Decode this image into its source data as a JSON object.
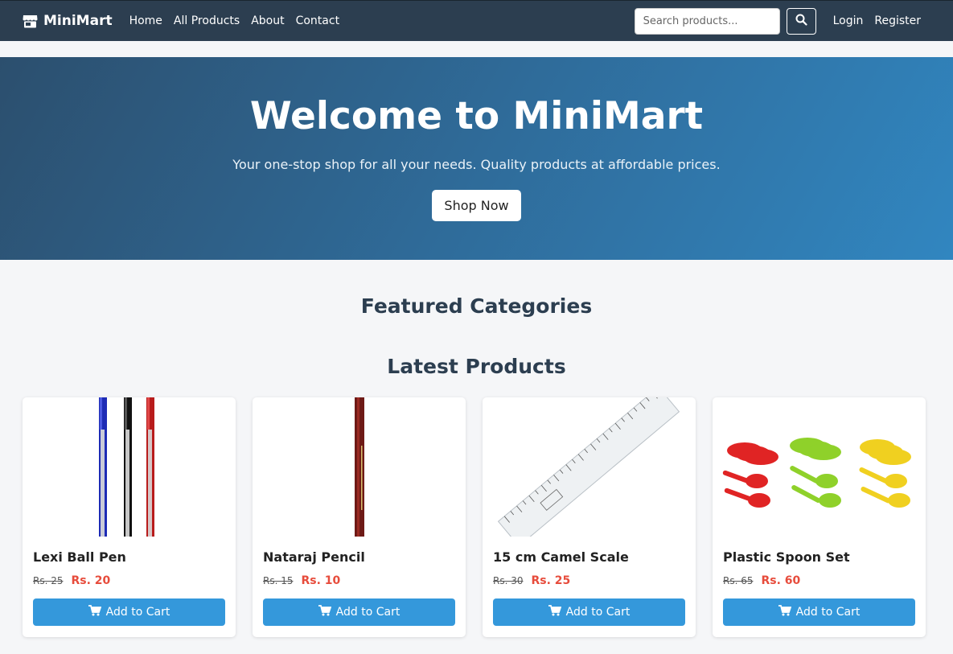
{
  "nav": {
    "brand": "MiniMart",
    "links": [
      "Home",
      "All Products",
      "About",
      "Contact"
    ],
    "search_placeholder": "Search products...",
    "login": "Login",
    "register": "Register"
  },
  "hero": {
    "title": "Welcome to MiniMart",
    "subtitle": "Your one-stop shop for all your needs. Quality products at affordable prices.",
    "button": "Shop Now"
  },
  "sections": {
    "featured": "Featured Categories",
    "latest": "Latest Products"
  },
  "products": [
    {
      "name": "Lexi Ball Pen",
      "old_price": "Rs. 25",
      "price": "Rs. 20",
      "button": "Add to Cart"
    },
    {
      "name": "Nataraj Pencil",
      "old_price": "Rs. 15",
      "price": "Rs. 10",
      "button": "Add to Cart"
    },
    {
      "name": "15 cm Camel Scale",
      "old_price": "Rs. 30",
      "price": "Rs. 25",
      "button": "Add to Cart"
    },
    {
      "name": "Plastic Spoon Set",
      "old_price": "Rs. 65",
      "price": "Rs. 60",
      "button": "Add to Cart"
    }
  ],
  "colors": {
    "navbar": "#2c3e50",
    "accent": "#3498db",
    "price": "#e74c3c"
  },
  "icons": {
    "brand": "store-icon",
    "search": "search-icon",
    "cart": "cart-icon"
  }
}
